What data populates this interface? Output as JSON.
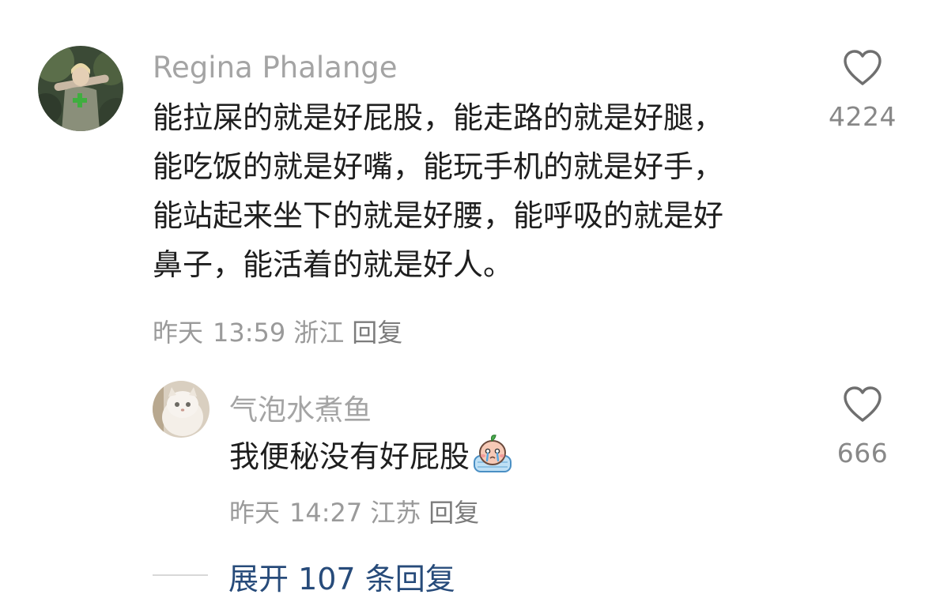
{
  "comment": {
    "username": "Regina Phalange",
    "text": "能拉屎的就是好屁股，能走路的就是好腿，\n能吃饭的就是好嘴，能玩手机的就是好手，\n能站起来坐下的就是好腰，能呼吸的就是好\n鼻子，能活着的就是好人。",
    "date": "昨天",
    "time": "13:59",
    "location": "浙江",
    "reply_label": "回复",
    "like_count": "4224",
    "like_icon": "heart-outline-icon"
  },
  "reply": {
    "username": "气泡水煮鱼",
    "text": "我便秘没有好屁股",
    "emoji": "crying-emoji-icon",
    "date": "昨天",
    "time": "14:27",
    "location": "江苏",
    "reply_label": "回复",
    "like_count": "666",
    "like_icon": "heart-outline-icon"
  },
  "expand": {
    "label": "展开 107 条回复"
  },
  "colors": {
    "username": "#a4a4a4",
    "meta": "#9a9a9a",
    "expand_link": "#274b7a",
    "heart_outline": "#6f6f6f"
  }
}
